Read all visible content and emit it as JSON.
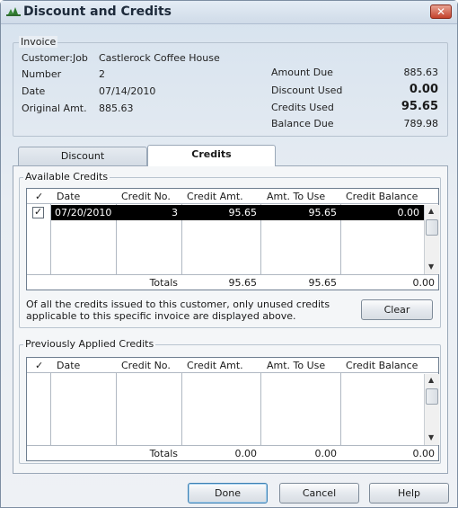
{
  "window": {
    "title": "Discount and Credits",
    "close_label": "✕"
  },
  "invoice": {
    "legend": "Invoice",
    "customer_label": "Customer:Job",
    "customer_value": "Castlerock Coffee House",
    "number_label": "Number",
    "number_value": "2",
    "date_label": "Date",
    "date_value": "07/14/2010",
    "original_label": "Original Amt.",
    "original_value": "885.63",
    "amount_due_label": "Amount Due",
    "amount_due_value": "885.63",
    "discount_used_label": "Discount Used",
    "discount_used_value": "0.00",
    "credits_used_label": "Credits Used",
    "credits_used_value": "95.65",
    "balance_due_label": "Balance Due",
    "balance_due_value": "789.98"
  },
  "tabs": [
    {
      "label": "Discount"
    },
    {
      "label": "Credits"
    }
  ],
  "available": {
    "legend": "Available Credits",
    "headers": [
      "✓",
      "Date",
      "Credit No.",
      "Credit Amt.",
      "Amt. To Use",
      "Credit Balance"
    ],
    "row": {
      "check": "✓",
      "date": "07/20/2010",
      "credit_no": "3",
      "credit_amt": "95.65",
      "amt_to_use": "95.65",
      "balance": "0.00"
    },
    "totals": {
      "label": "Totals",
      "credit_amt": "95.65",
      "amt_to_use": "95.65",
      "balance": "0.00"
    }
  },
  "note": {
    "line1": "Of all the credits issued to this customer, only unused credits",
    "line2": "applicable to this specific invoice are displayed above."
  },
  "clear_label": "Clear",
  "previous": {
    "legend": "Previously Applied Credits",
    "headers": [
      "✓",
      "Date",
      "Credit No.",
      "Credit Amt.",
      "Amt. To Use",
      "Credit Balance"
    ],
    "totals": {
      "label": "Totals",
      "credit_amt": "0.00",
      "amt_to_use": "0.00",
      "balance": "0.00"
    }
  },
  "buttons": {
    "done": "Done",
    "cancel": "Cancel",
    "help": "Help"
  },
  "icons": {
    "app": "quickbooks-tree-icon",
    "scroll_up": "▲",
    "scroll_down": "▼"
  }
}
